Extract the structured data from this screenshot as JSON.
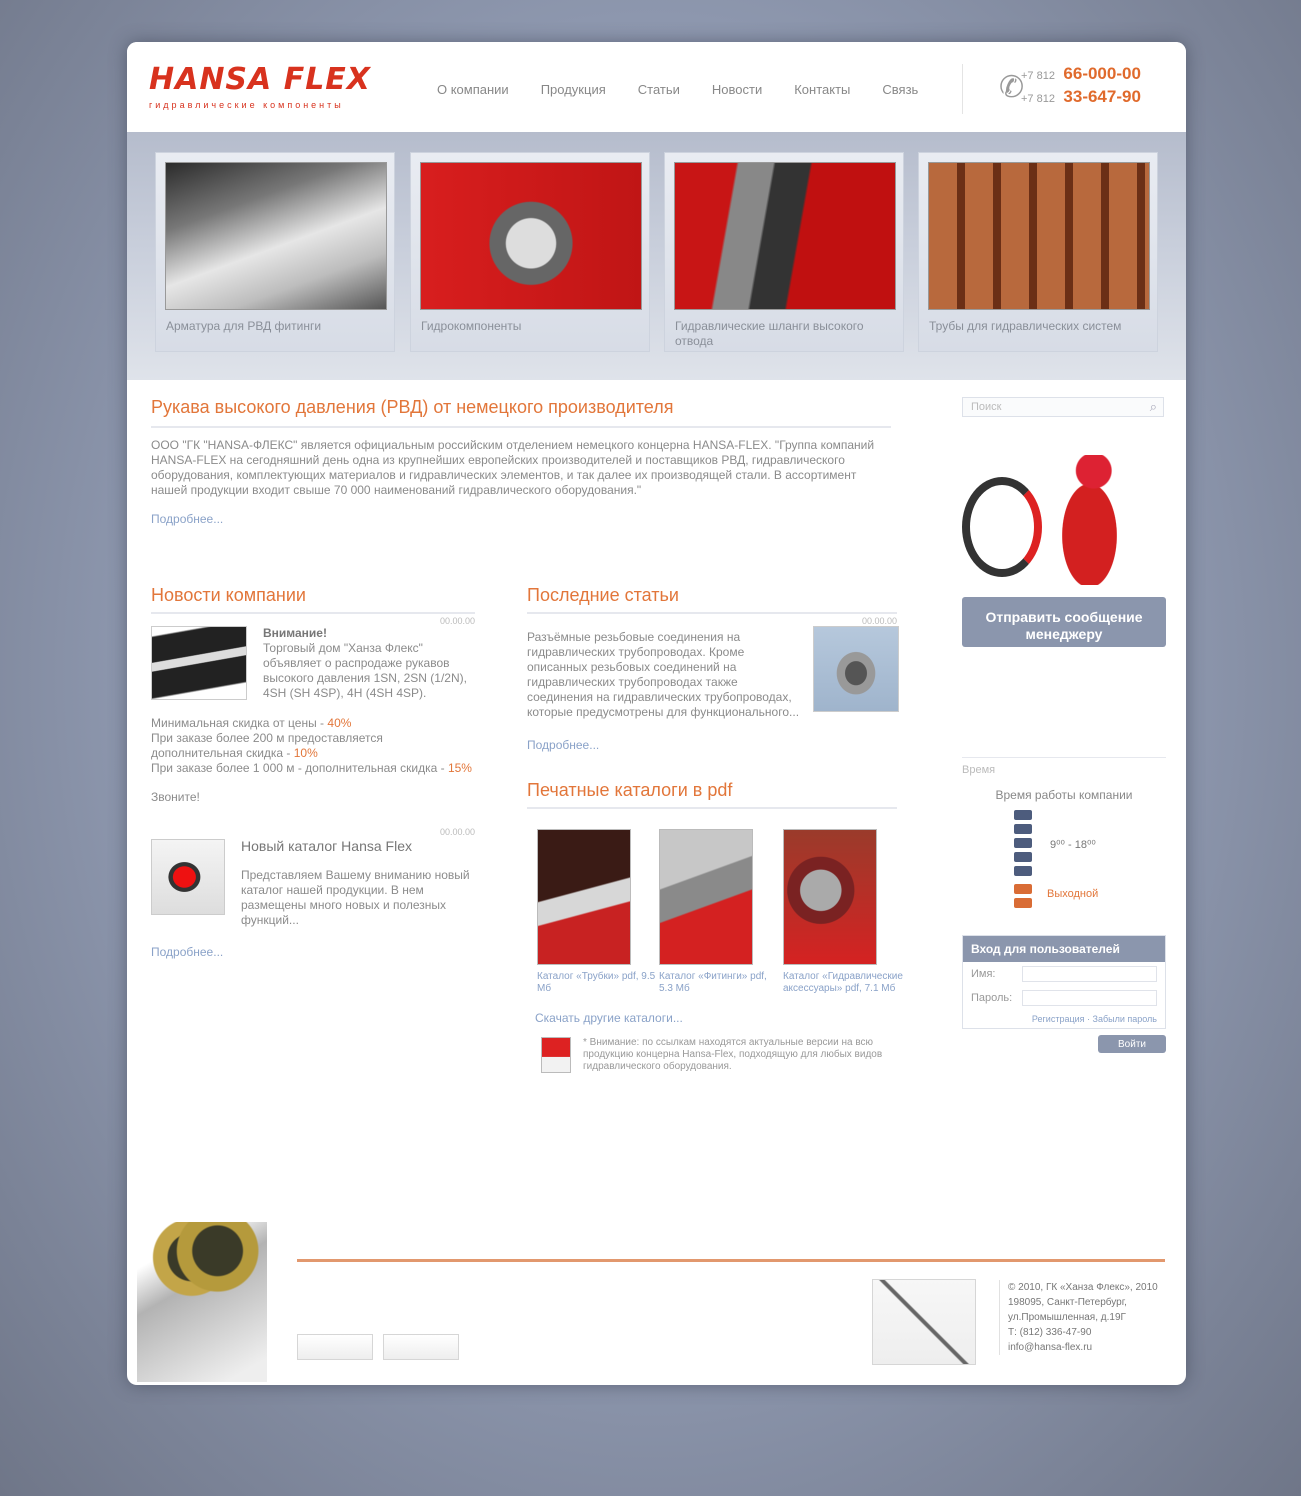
{
  "header": {
    "logo_text": "HANSA FLEX",
    "logo_sub": "гидравлические компоненты",
    "nav": [
      "О компании",
      "Продукция",
      "Статьи",
      "Новости",
      "Контакты",
      "Связь"
    ],
    "phones": [
      {
        "code": "+7 812",
        "number": "66-000-00"
      },
      {
        "code": "+7 812",
        "number": "33-647-90"
      }
    ]
  },
  "banner": {
    "slides": [
      {
        "caption": "Арматура для РВД фитинги"
      },
      {
        "caption": "Гидрокомпоненты"
      },
      {
        "caption": "Гидравлические шланги высокого отвода"
      },
      {
        "caption": "Трубы для гидравлических систем"
      }
    ]
  },
  "main": {
    "title": "Рукава высокого давления (РВД) от немецкого производителя",
    "intro": "ООО \"ГК \"HANSA-ФЛЕКС\" является официальным российским отделением немецкого концерна HANSA-FLEX. \"Группа компаний HANSA-FLEX на сегодняшний день одна из крупнейших европейских производителей и поставщиков РВД, гидравлического оборудования, комплектующих материалов и гидравлических элементов, и так далее их производящей стали. В ассортимент нашей продукции входит свыше 70 000 наименований гидравлического оборудования.\"",
    "more": "Подробнее..."
  },
  "news": {
    "title": "Новости компании",
    "date1": "00.00.00",
    "item1_title": "Внимание!",
    "item1_text": "Торговый дом \"Ханза Флекс\" объявляет о распродаже рукавов высокого давления 1SN, 2SN (1/2N), 4SH (SH 4SP), 4H (4SH 4SP).",
    "promo": [
      {
        "text": "Минимальная скидка от цены - ",
        "value": "40%"
      },
      {
        "text": "При заказе более 200 м предоставляется дополнительная скидка - ",
        "value": "10%"
      },
      {
        "text": "При заказе более 1 000 м - дополнительная скидка - ",
        "value": "15%"
      }
    ],
    "hurry": "Звоните!",
    "date2": "00.00.00",
    "item2_title": "Новый каталог Hansa Flex",
    "item2_text": "Представляем Вашему вниманию новый каталог нашей продукции. В нем размещены много новых и полезных функций...",
    "more": "Подробнее..."
  },
  "articles": {
    "title": "Последние статьи",
    "date": "00.00.00",
    "text": "Разъёмные резьбовые соединения на гидравлических трубопроводах. Кроме описанных резьбовых соединений на гидравлических трубопроводах также соединения на гидравлических трубопроводах, которые предусмотрены для функционального...",
    "more": "Подробнее..."
  },
  "catalogs": {
    "title": "Печатные каталоги в pdf",
    "items": [
      {
        "caption": "Каталог «Трубки» pdf, 9.5 Мб"
      },
      {
        "caption": "Каталог «Фитинги» pdf, 5.3 Мб"
      },
      {
        "caption": "Каталог «Гидравлические аксессуары» pdf, 7.1 Мб"
      }
    ],
    "other": "Скачать другие каталоги...",
    "note": "* Внимание: по ссылкам находятся актуальные версии на всю продукцию концерна Hansa-Flex, подходящую для любых видов гидравлического оборудования."
  },
  "sidebar": {
    "search_placeholder": "Поиск",
    "contact_button": "Отправить сообщение менеджеру",
    "hours_heading": "Время",
    "hours_title": "Время работы компании",
    "hours_time": "9⁰⁰ - 18⁰⁰",
    "hours_off": "Выходной",
    "login_title": "Вход для пользователей",
    "login_name": "Имя:",
    "login_pass": "Пароль:",
    "login_links": "Регистрация · Забыли пароль",
    "login_button": "Войти"
  },
  "footer": {
    "address": [
      "© 2010, ГК «Ханза Флекс», 2010",
      "198095, Санкт-Петербург,",
      "ул.Промышленная, д.19Г",
      "Т: (812) 336-47-90",
      "info@hansa-flex.ru"
    ]
  }
}
